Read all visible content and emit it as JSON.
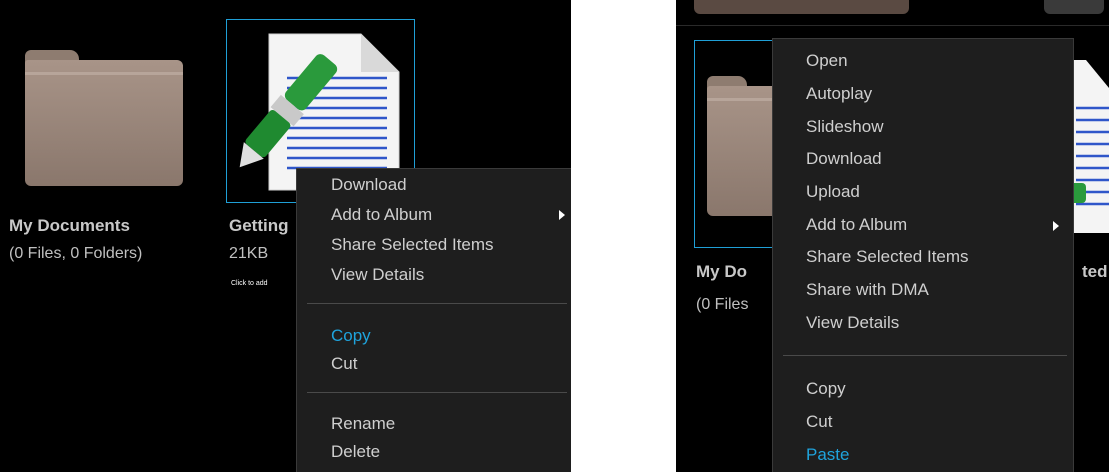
{
  "left": {
    "items": [
      {
        "name": "My Documents",
        "meta": "(0 Files, 0 Folders)",
        "icon": "folder-icon"
      },
      {
        "name": "Getting",
        "meta": "21KB",
        "hint": "Click to add",
        "icon": "document-edit-icon"
      }
    ],
    "menu": {
      "groups": [
        [
          {
            "label": "Download"
          },
          {
            "label": "Add to Album",
            "submenu": true
          },
          {
            "label": "Share Selected Items"
          },
          {
            "label": "View Details"
          }
        ],
        [
          {
            "label": "Copy",
            "active": true
          },
          {
            "label": "Cut"
          }
        ],
        [
          {
            "label": "Rename"
          },
          {
            "label": "Delete"
          }
        ]
      ]
    }
  },
  "right": {
    "items": [
      {
        "name": "My Do",
        "meta": "(0 Files",
        "icon": "folder-icon"
      },
      {
        "name": "ted",
        "icon": "document-edit-icon"
      }
    ],
    "menu": {
      "groups": [
        [
          {
            "label": "Open"
          },
          {
            "label": "Autoplay"
          },
          {
            "label": "Slideshow"
          },
          {
            "label": "Download"
          },
          {
            "label": "Upload"
          },
          {
            "label": "Add to Album",
            "submenu": true
          },
          {
            "label": "Share Selected Items"
          },
          {
            "label": "Share with DMA"
          },
          {
            "label": "View Details"
          }
        ],
        [
          {
            "label": "Copy"
          },
          {
            "label": "Cut"
          },
          {
            "label": "Paste",
            "active": true
          }
        ]
      ]
    }
  },
  "colors": {
    "background": "#000000",
    "menu_bg": "#1e1e1e",
    "menu_text": "#cfcfcf",
    "active_text": "#1fa3dc",
    "selection_border": "#1f9fd6",
    "folder": "#9c887c"
  }
}
